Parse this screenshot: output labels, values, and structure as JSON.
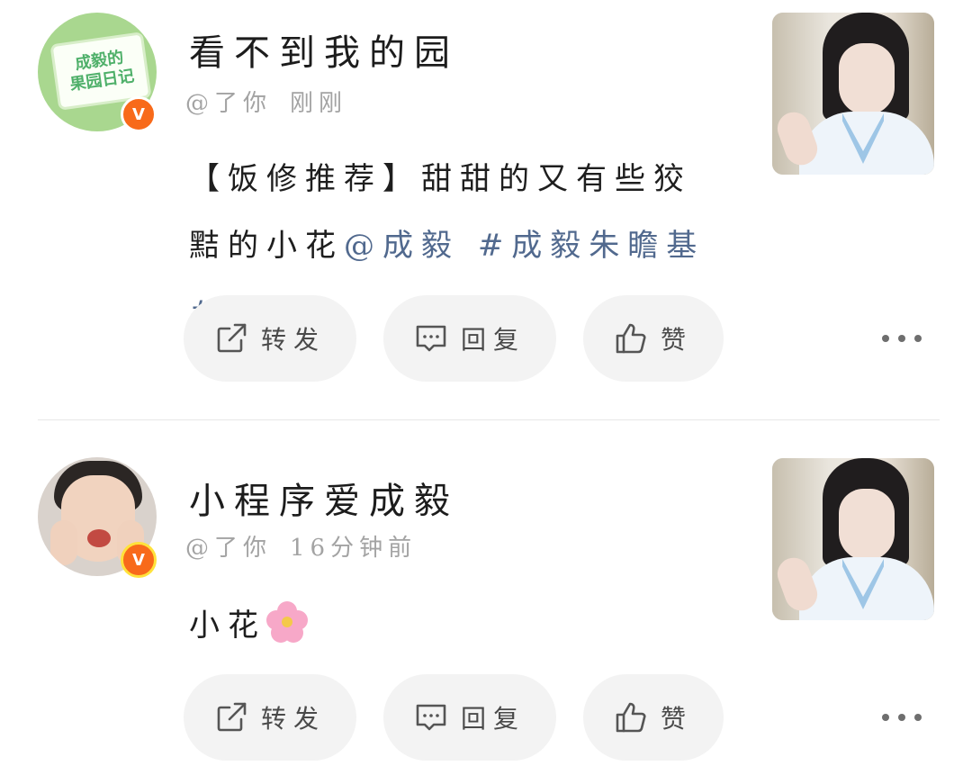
{
  "posts": [
    {
      "username": "看不到我的园",
      "avatar_text_line1": "成毅的",
      "avatar_text_line2": "果园日记",
      "verified_badge": "V",
      "mention_prefix": "@了你",
      "time": "刚刚",
      "content_text": "【饭修推荐】甜甜的又有些狡黠的小花",
      "content_mention": "@成毅",
      "content_hashtag": "#成毅朱瞻基#",
      "actions": {
        "repost": "转发",
        "reply": "回复",
        "like": "赞"
      }
    },
    {
      "username": "小程序爱成毅",
      "verified_badge": "V",
      "mention_prefix": "@了你",
      "time": "16分钟前",
      "content_text": "小花",
      "actions": {
        "repost": "转发",
        "reply": "回复",
        "like": "赞"
      }
    }
  ],
  "icons": {
    "repost": "share-arrow-icon",
    "reply": "comment-bubble-icon",
    "like": "thumbs-up-icon",
    "more": "more-dots-icon",
    "verified": "verified-v-icon",
    "flower": "cherry-blossom-icon"
  },
  "colors": {
    "link": "#51698e",
    "button_bg": "#f3f3f3",
    "verified": "#f86a1a",
    "meta": "#a3a3a3"
  }
}
